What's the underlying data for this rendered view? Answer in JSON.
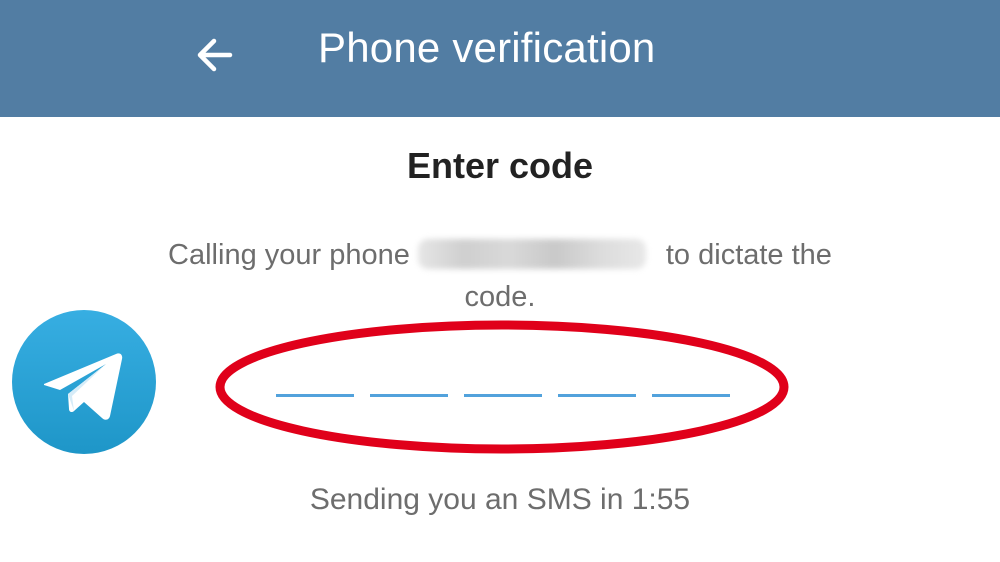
{
  "header": {
    "title": "Phone verification",
    "back_icon": "arrow-left-icon",
    "background_color": "#527da3"
  },
  "main": {
    "heading": "Enter code",
    "description_prefix": "Calling your phone",
    "description_suffix": "to dictate the code.",
    "code_digits": [
      "",
      "",
      "",
      "",
      ""
    ],
    "status_text": "Sending you an SMS in 1:55"
  },
  "logo": {
    "icon": "telegram-logo-icon",
    "color": "#2aa3df"
  },
  "annotation": {
    "color": "#e0001a"
  },
  "colors": {
    "accent": "#52a2dc",
    "text_dark": "#222222",
    "text_muted": "#6d6d6d"
  }
}
